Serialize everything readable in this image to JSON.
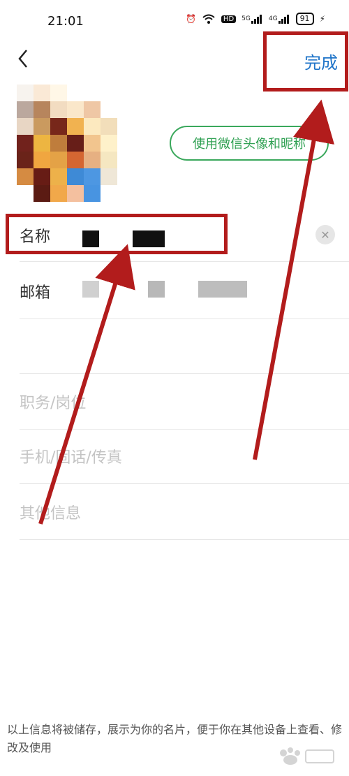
{
  "status_bar": {
    "time": "21:01",
    "icons": [
      "alarm-icon",
      "wifi-icon",
      "hd-icon",
      "signal-5g-icon",
      "signal-4g-icon",
      "battery-icon",
      "charging-icon"
    ],
    "hd": "HD",
    "net1": "5G",
    "net2": "4G",
    "battery": "91"
  },
  "header": {
    "back_icon": "chevron-left-icon",
    "done_label": "完成"
  },
  "profile": {
    "wechat_button": "使用微信头像和昵称"
  },
  "fields": {
    "name_label": "名称",
    "email_label": "邮箱",
    "position_placeholder": "职务/岗位",
    "phone_placeholder": "手机/固话/传真",
    "other_placeholder": "其他信息"
  },
  "footer": {
    "note": "以上信息将被储存，展示为你的名片，便于你在其他设备上查看、修改及使用"
  },
  "colors": {
    "accent_blue": "#1f74c9",
    "green": "#2fa052",
    "annotation_red": "#b21c1c"
  }
}
